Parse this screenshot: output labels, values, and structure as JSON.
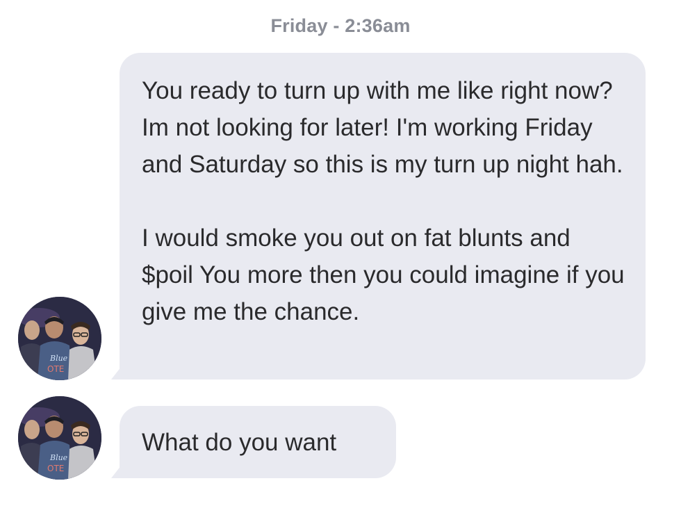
{
  "conversation": {
    "timestamp": "Friday - 2:36am",
    "messages": [
      {
        "sender": "incoming",
        "paragraphs": [
          "You ready to turn up with me like right now? Im not looking for later! I'm working Friday and Saturday so this is my turn up night hah.",
          "I would smoke you out on fat blunts and $poil You more then you could imagine if you give me the chance."
        ]
      },
      {
        "sender": "incoming",
        "paragraphs": [
          "What do you want"
        ]
      }
    ]
  },
  "colors": {
    "bubble_background": "#e9eaf1",
    "bubble_text": "#2a2a2c",
    "timestamp_text": "#8a8d96",
    "page_background": "#ffffff"
  },
  "icons": {
    "avatar": "group-photo-avatar"
  }
}
